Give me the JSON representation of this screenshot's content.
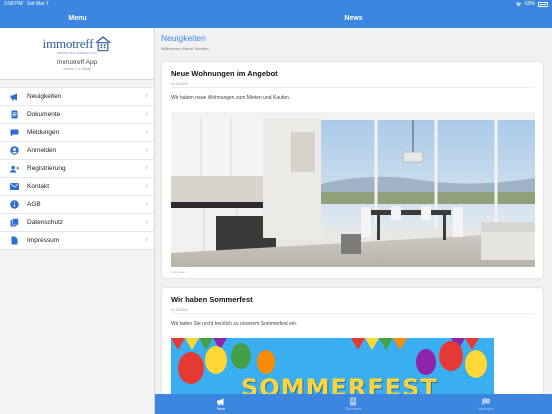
{
  "status_bar": {
    "time": "3:58 PM",
    "date": "Sat Mar 7",
    "battery": "69%"
  },
  "left_nav": {
    "title": "Menu"
  },
  "right_nav": {
    "title": "News"
  },
  "brand": {
    "logo_text": "immotreff",
    "logo_sub": "IMMOBILIEN-VERWALTUNG",
    "app_name": "Immotreff App",
    "version": "Version 2.1 (Ideal)"
  },
  "menu": {
    "items": [
      {
        "label": "Neuigkeiten",
        "icon": "megaphone-icon"
      },
      {
        "label": "Dokumente",
        "icon": "document-icon"
      },
      {
        "label": "Meldungen",
        "icon": "chat-bubble-icon"
      },
      {
        "label": "Anmelden",
        "icon": "user-icon"
      },
      {
        "label": "Registrierung",
        "icon": "add-user-icon"
      },
      {
        "label": "Kontakt",
        "icon": "envelope-icon"
      },
      {
        "label": "AGB",
        "icon": "info-icon"
      },
      {
        "label": "Datenschutz",
        "icon": "cards-icon"
      },
      {
        "label": "Impressum",
        "icon": "page-icon"
      }
    ]
  },
  "content": {
    "section_title": "Neuigkeiten",
    "section_subtitle": "Willkommen, Marcel Tschofen",
    "cards": [
      {
        "title": "Neue Wohnungen im Angebot",
        "date": "01.03.2020",
        "text": "Wir haben neue Wohnungen zum Mieten und Kaufen.",
        "caption": "mehr lesen"
      },
      {
        "title": "Wir haben Sommerfest",
        "date": "01.03.2020",
        "text": "Wir laden Sie recht herzlich zu unserem Sommerfest ein.",
        "banner_text": "SOMMERFEST"
      }
    ]
  },
  "tabbar": {
    "tabs": [
      {
        "label": "News",
        "icon": "megaphone-icon",
        "active": true
      },
      {
        "label": "Dokumente",
        "icon": "document-icon",
        "active": false
      },
      {
        "label": "Meldungen",
        "icon": "chat-bubble-icon",
        "active": false
      }
    ]
  },
  "colors": {
    "accent": "#3d86e0",
    "sidebar_bg": "#f3f3f5",
    "content_bg": "#f1f1f4"
  }
}
